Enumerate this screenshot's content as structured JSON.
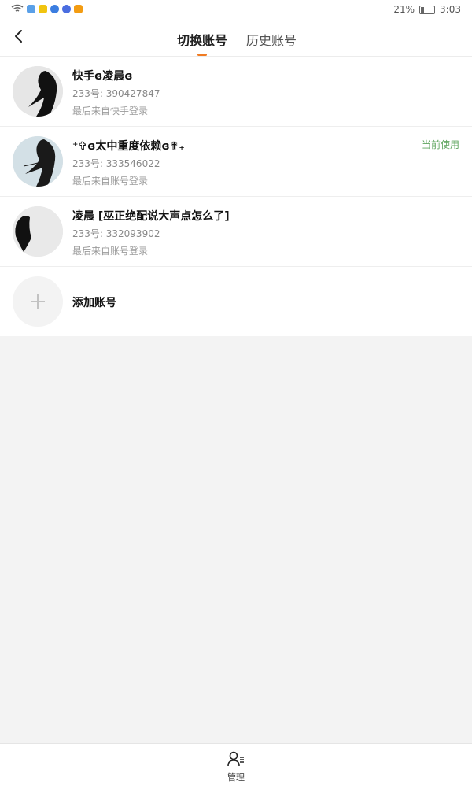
{
  "status_bar": {
    "battery": "21%",
    "time": "3:03",
    "battery_level": 0.21
  },
  "header": {
    "tabs": [
      {
        "label": "切换账号",
        "active": true
      },
      {
        "label": "历史账号",
        "active": false
      }
    ]
  },
  "accounts": [
    {
      "name": "快手ɞ凌晨ɞ",
      "uid": "233号: 390427847",
      "last_login": "最后来自快手登录",
      "current": ""
    },
    {
      "name": "⁺✞ɞ太中重度依赖ɞ✟₊",
      "uid": "233号: 333546022",
      "last_login": "最后来自账号登录",
      "current": "当前使用"
    },
    {
      "name": "凌晨 [巫正绝配说大声点怎么了]",
      "uid": "233号: 332093902",
      "last_login": "最后来自账号登录",
      "current": ""
    }
  ],
  "add_account": {
    "label": "添加账号"
  },
  "bottom_bar": {
    "manage_label": "管理"
  }
}
